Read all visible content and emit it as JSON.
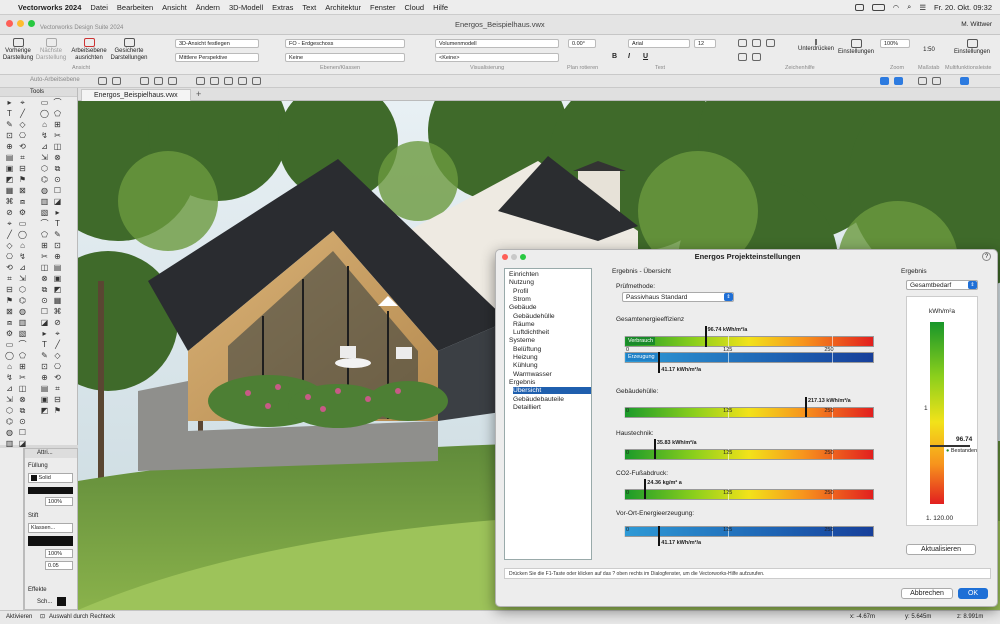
{
  "menubar": {
    "app": "Vectorworks 2024",
    "items": [
      "Datei",
      "Bearbeiten",
      "Ansicht",
      "Ändern",
      "3D-Modell",
      "Extras",
      "Text",
      "Architektur",
      "Fenster",
      "Cloud",
      "Hilfe"
    ],
    "clock": "Fr. 20. Okt.  09:32"
  },
  "window": {
    "subtitle": "Vectorworks Design Suite 2024",
    "document": "Energos_Beispielhaus.vwx",
    "user": "M. Wittwer"
  },
  "toolbar": {
    "vorherige": "Vorherige Darstellung",
    "naechste": "Nächste Darstellung",
    "arbeitsebene": "Arbeitsebene ausrichten",
    "gesicherte": "Gesicherte Darstellungen",
    "grp_ansicht": "Ansicht",
    "view3d": "3D-Ansicht festlegen",
    "perspective": "Mittlere Perspektive",
    "layer": "FO - Erdgeschoss",
    "klasse": "Keine",
    "grp_ebenen": "Ebenen/Klassen",
    "render": "Volumenmodell",
    "render2": "<Keine>",
    "grp_visual": "Visualisierung",
    "rotation": "0.00°",
    "grp_plan": "Plan rotieren",
    "font": "Arial",
    "fontsize": "12",
    "grp_text": "Text",
    "unterdruecken": "Unterdrücken",
    "einstellungen": "Einstellungen",
    "grp_zeichen": "Zeichenhilfe",
    "zoom": "100%",
    "grp_zoom": "Zoom",
    "scale": "1:50",
    "grp_massstab": "Maßstab",
    "einst2": "Einstellungen",
    "grp_multi": "Multifunktionsleiste",
    "bold": "B",
    "italic": "I",
    "underline": "U"
  },
  "row2": {
    "layer_label": "Auto-Arbeitsebene"
  },
  "tools_title": "Tools",
  "attributes": {
    "title": "Attri...",
    "fill_label": "Füllung",
    "fill_value": "Solid",
    "fill_opacity": "100%",
    "pen_label": "Stift",
    "pen_value": "Klassen...",
    "pen_opacity": "100%",
    "line_width": "0.05",
    "effects_label": "Effekte",
    "effects_value": "Sch..."
  },
  "tab": {
    "name": "Energos_Beispielhaus.vwx",
    "plus": "+"
  },
  "status": {
    "left1": "Aktivieren",
    "left2": "Auswahl durch Rechteck",
    "x": "x: -4.67m",
    "y": "y: 5.645m",
    "z": "z: 8.991m"
  },
  "dialog": {
    "title": "Energos Projekteinstellungen",
    "help": "?",
    "nav": [
      {
        "label": "Einrichten",
        "indent": 0
      },
      {
        "label": "Nutzung",
        "indent": 0
      },
      {
        "label": "Profil",
        "indent": 1
      },
      {
        "label": "Strom",
        "indent": 1
      },
      {
        "label": "Gebäude",
        "indent": 0
      },
      {
        "label": "Gebäudehülle",
        "indent": 1
      },
      {
        "label": "Räume",
        "indent": 1
      },
      {
        "label": "Luftdichtheit",
        "indent": 1
      },
      {
        "label": "Systeme",
        "indent": 0
      },
      {
        "label": "Belüftung",
        "indent": 1
      },
      {
        "label": "Heizung",
        "indent": 1
      },
      {
        "label": "Kühlung",
        "indent": 1
      },
      {
        "label": "Warmwasser",
        "indent": 1
      },
      {
        "label": "Ergebnis",
        "indent": 0
      },
      {
        "label": "Übersicht",
        "indent": 1
      },
      {
        "label": "Gebäudebauteile",
        "indent": 1
      },
      {
        "label": "Detailliert",
        "indent": 1
      }
    ],
    "selected_nav": "Übersicht",
    "section_title": "Ergebnis - Übersicht",
    "method_label": "Prüfmethode:",
    "method_value": "Passivhaus Standard",
    "scale_ticks": [
      "0",
      "125",
      "250"
    ],
    "gesamt_label": "Gesamtenergieeffizienz",
    "verbrauch": {
      "pill": "Verbrauch",
      "value": 96.74,
      "text": "96.74 kWh/m²/a"
    },
    "erzeugung": {
      "pill": "Erzeugung",
      "value": 41.17,
      "text": "41.17 kWh/m²/a"
    },
    "bars": [
      {
        "label": "Gebäudehülle:",
        "value": 217.13,
        "text": "217.13 kWh/m²/a",
        "color": "gradient"
      },
      {
        "label": "Haustechnik:",
        "value": 35.83,
        "text": "35.83 kWh/m²/a",
        "color": "gradient"
      },
      {
        "label": "CO2-Fußabdruck:",
        "value": 24.36,
        "text": "24.36 kg/m² a",
        "color": "gradient"
      },
      {
        "label": "Vor-Ort-Energieerzeugung:",
        "value": 41.17,
        "text": "41.17 kWh/m²/a",
        "color": "blue"
      }
    ],
    "result_label": "Ergebnis",
    "result_select": "Gesamtbedarf",
    "unit": "kWh/m²a",
    "gauge_top": "1",
    "gauge_bottom": "1. 120.00",
    "gauge_value": "96.74",
    "gauge_note": "Bestanden",
    "update_button": "Aktualisieren",
    "hint": "Drücken Sie die F1-Taste oder klicken auf das ? oben rechts im Dialogfenster, um die Vectorworks-Hilfe aufzurufen.",
    "cancel": "Abbrechen",
    "ok": "OK"
  },
  "colors": {
    "accent": "#1f5fae",
    "ok": "#1d6fd6"
  }
}
